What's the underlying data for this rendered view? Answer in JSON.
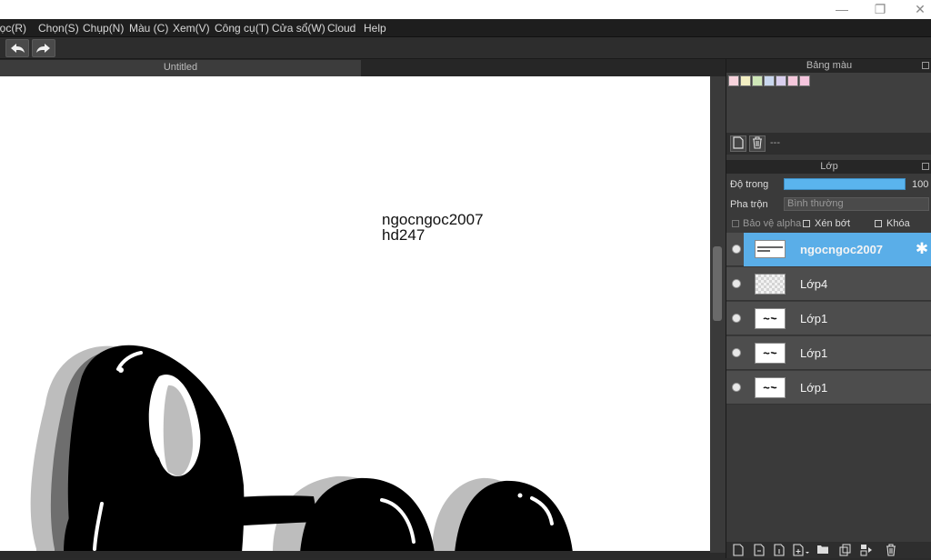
{
  "window": {
    "minimize_glyph": "—",
    "restore_glyph": "❐",
    "close_glyph": "✕"
  },
  "menu": {
    "items": [
      "lọc(R)",
      "Chọn(S)",
      "Chụp(N)",
      "Màu (C)",
      "Xem(V)",
      "Công cụ(T)",
      "Cửa sổ(W)",
      "Cloud",
      "Help"
    ]
  },
  "toolbar": {
    "undo_icon": "undo-arrow-icon",
    "redo_icon": "redo-arrow-icon"
  },
  "document": {
    "tab_title": "Untitled",
    "canvas_text_line1": "ngocngoc2007",
    "canvas_text_line2": "hd247"
  },
  "palette_panel": {
    "title": "Bảng màu",
    "swatches": [
      "#f7d3dc",
      "#f3efc3",
      "#cfe7b8",
      "#c9d7ee",
      "#d9cfee",
      "#f5c8dc",
      "#f4c5dd"
    ],
    "set_name": "---"
  },
  "layer_panel": {
    "title": "Lớp",
    "opacity_label": "Độ trong",
    "opacity_value": "100",
    "opacity_fraction": 1.0,
    "blend_label": "Pha trộn",
    "blend_value": "Bình thường",
    "protect_alpha_label": "Bảo vệ alpha",
    "clipping_label": "Xén bớt",
    "lock_label": "Khóa",
    "layers": [
      {
        "name": "ngocngoc2007",
        "selected": true
      },
      {
        "name": "Lớp4",
        "selected": false
      },
      {
        "name": "Lớp1",
        "selected": false
      },
      {
        "name": "Lớp1",
        "selected": false
      },
      {
        "name": "Lớp1",
        "selected": false
      }
    ]
  },
  "colors": {
    "accent": "#5aaee8",
    "panel_bg": "#3a3a3a",
    "menubar_bg": "#1e1e1e",
    "canvas_bg": "#ffffff"
  }
}
